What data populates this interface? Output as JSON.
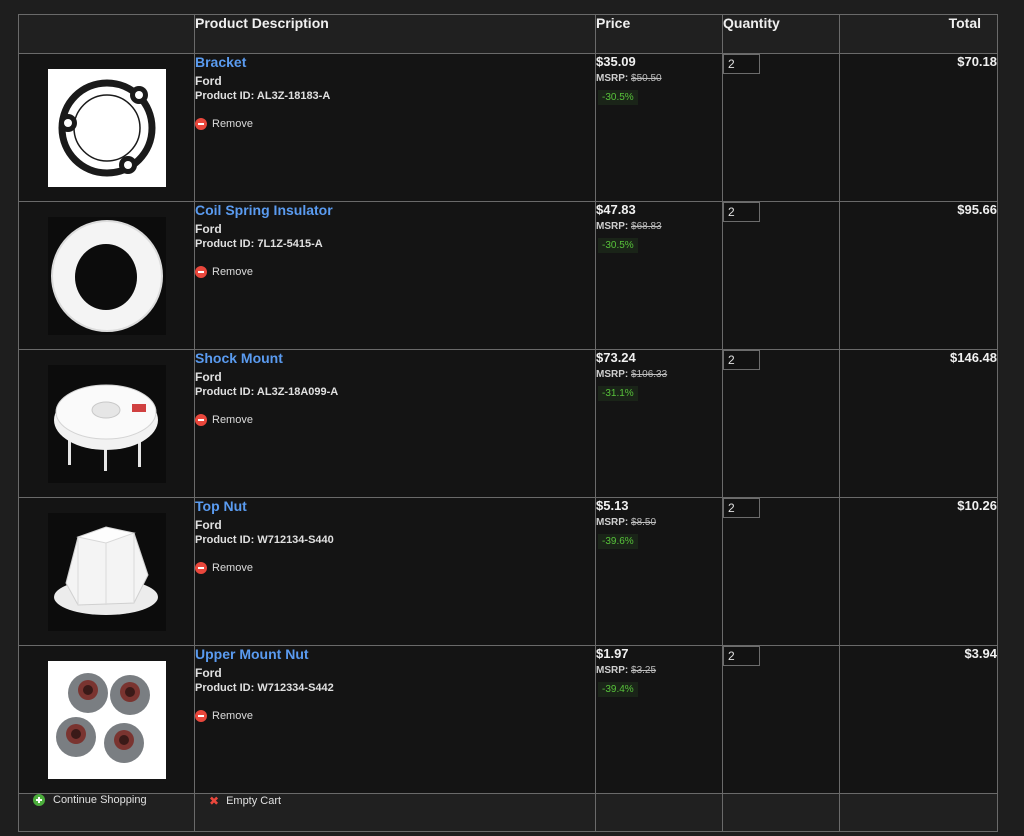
{
  "columns": {
    "image": "",
    "description": "Product Description",
    "price": "Price",
    "quantity": "Quantity",
    "total": "Total"
  },
  "items": [
    {
      "name": "Bracket",
      "brand": "Ford",
      "product_id": "Product ID: AL3Z-18183-A",
      "remove": "Remove",
      "price": "$35.09",
      "msrp_label": "MSRP:",
      "msrp": "$50.50",
      "discount": "-30.5%",
      "quantity": "2",
      "total": "$70.18",
      "image_icon": "gasket-icon"
    },
    {
      "name": "Coil Spring Insulator",
      "brand": "Ford",
      "product_id": "Product ID: 7L1Z-5415-A",
      "remove": "Remove",
      "price": "$47.83",
      "msrp_label": "MSRP:",
      "msrp": "$68.83",
      "discount": "-30.5%",
      "quantity": "2",
      "total": "$95.66",
      "image_icon": "insulator-ring-icon"
    },
    {
      "name": "Shock Mount",
      "brand": "Ford",
      "product_id": "Product ID: AL3Z-18A099-A",
      "remove": "Remove",
      "price": "$73.24",
      "msrp_label": "MSRP:",
      "msrp": "$106.33",
      "discount": "-31.1%",
      "quantity": "2",
      "total": "$146.48",
      "image_icon": "shock-mount-icon"
    },
    {
      "name": "Top Nut",
      "brand": "Ford",
      "product_id": "Product ID: W712134-S440",
      "remove": "Remove",
      "price": "$5.13",
      "msrp_label": "MSRP:",
      "msrp": "$8.50",
      "discount": "-39.6%",
      "quantity": "2",
      "total": "$10.26",
      "image_icon": "hex-nut-icon"
    },
    {
      "name": "Upper Mount Nut",
      "brand": "Ford",
      "product_id": "Product ID: W712334-S442",
      "remove": "Remove",
      "price": "$1.97",
      "msrp_label": "MSRP:",
      "msrp": "$3.25",
      "discount": "-39.4%",
      "quantity": "2",
      "total": "$3.94",
      "image_icon": "flange-nuts-icon"
    }
  ],
  "footer": {
    "continue_shopping": "Continue Shopping",
    "empty_cart": "Empty Cart"
  },
  "colors": {
    "link": "#5a9bf0",
    "discount": "#57c23a",
    "remove": "#e9473c",
    "continue": "#4cae3c"
  }
}
